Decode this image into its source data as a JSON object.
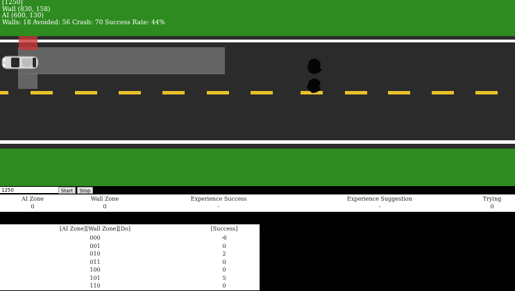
{
  "hud": {
    "line1": "[1250]",
    "line2": "Wall (830, 158)",
    "line3": "AI (600, 130)",
    "line4": "Walls: 18 Avoided: 56 Crash: 70 Success Rate: 44%"
  },
  "controls": {
    "input_value": "1250",
    "start_label": "Start",
    "stop_label": "Stop"
  },
  "status": {
    "ai_zone_label": "AI Zone",
    "ai_zone_value": "0",
    "wall_zone_label": "Wall Zone",
    "wall_zone_value": "0",
    "exp_success_label": "Experience Success",
    "exp_success_value": "-",
    "exp_suggestion_label": "Experience Suggestion",
    "exp_suggestion_value": "-",
    "trying_label": "Trying",
    "trying_value": "0"
  },
  "table": {
    "header_key": "[AI Zone][Wall Zone][Do]",
    "header_success": "[Success]",
    "rows": [
      {
        "key": "000",
        "success": "-6"
      },
      {
        "key": "001",
        "success": "0"
      },
      {
        "key": "010",
        "success": "2"
      },
      {
        "key": "011",
        "success": "0"
      },
      {
        "key": "100",
        "success": "0"
      },
      {
        "key": "101",
        "success": "5"
      },
      {
        "key": "110",
        "success": "0"
      }
    ]
  },
  "colors": {
    "grass": "#2e8b20",
    "road": "#2b2b2b",
    "lane_dash": "#e8c12a",
    "wall_zone": "#c83a3a"
  }
}
